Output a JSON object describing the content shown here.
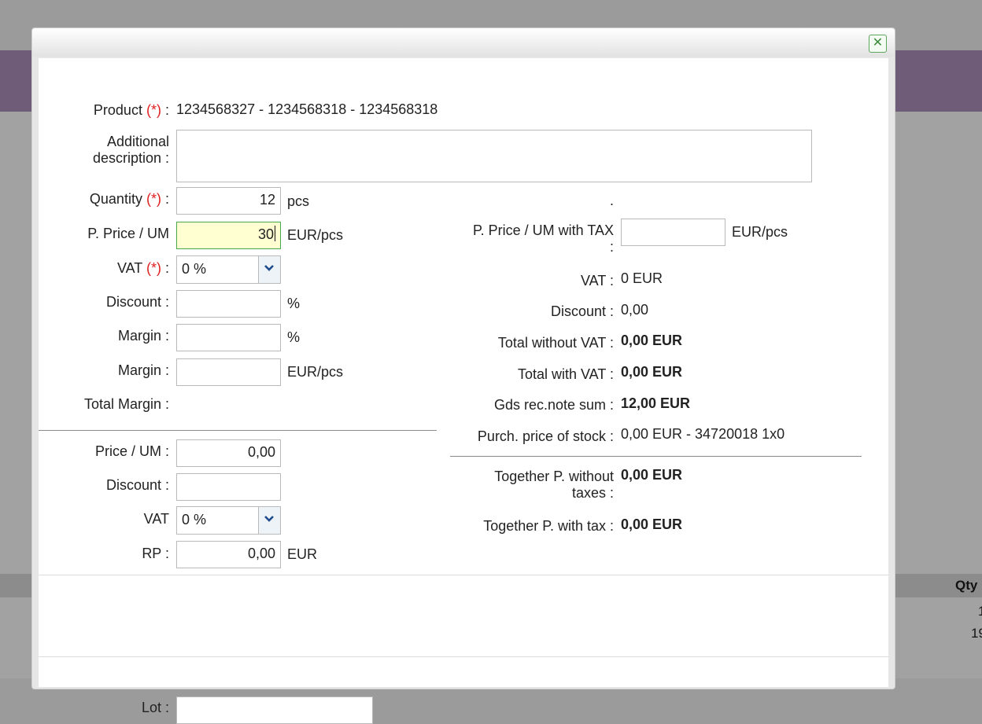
{
  "background": {
    "grid_header_qty": "Qty",
    "grid_cell_1": "1",
    "grid_cell_2": "19"
  },
  "dialog": {
    "close_icon": "close-icon",
    "left": {
      "product_label": "Product",
      "required_marker": "(*)",
      "colon": ":",
      "product_value": "1234568327 - 1234568318 - 1234568318",
      "additional_description_label_1": "Additional",
      "additional_description_label_2": "description :",
      "additional_description_value": "",
      "quantity_label": "Quantity",
      "quantity_value": "12",
      "quantity_unit": "pcs",
      "pprice_label": "P. Price / UM",
      "pprice_value": "30",
      "pprice_unit": "EUR/pcs",
      "vat_label": "VAT",
      "vat_selected": "0 %",
      "discount_label": "Discount :",
      "discount_value": "",
      "discount_unit": "%",
      "margin_label": "Margin :",
      "margin_pct_value": "",
      "margin_pct_unit": "%",
      "margin_eur_value": "",
      "margin_eur_unit": "EUR/pcs",
      "total_margin_label": "Total Margin :",
      "price_um_label": "Price / UM :",
      "price_um_value": "0,00",
      "discount2_label": "Discount :",
      "discount2_value": "",
      "vat2_label": "VAT",
      "vat2_selected": "0 %",
      "rp_label": "RP :",
      "rp_value": "0,00",
      "rp_unit": "EUR",
      "lot_label": "Lot :"
    },
    "right": {
      "dot": ".",
      "pprice_tax_label_1": "P. Price / UM with TAX",
      "pprice_tax_label_2": ":",
      "pprice_tax_value": "",
      "pprice_tax_unit": "EUR/pcs",
      "vat_label": "VAT :",
      "vat_value": "0 EUR",
      "discount_label": "Discount :",
      "discount_value": "0,00",
      "total_without_vat_label": "Total without VAT :",
      "total_without_vat_value": "0,00 EUR",
      "total_with_vat_label": "Total with VAT :",
      "total_with_vat_value": "0,00 EUR",
      "gds_label": "Gds rec.note sum :",
      "gds_value": "12,00 EUR",
      "purch_label": "Purch. price of stock :",
      "purch_value": "0,00 EUR - 34720018 1x0",
      "together_without_label_1": "Together P. without",
      "together_without_label_2": "taxes :",
      "together_without_value": "0,00 EUR",
      "together_with_label": "Together P. with tax :",
      "together_with_value": "0,00 EUR"
    }
  }
}
